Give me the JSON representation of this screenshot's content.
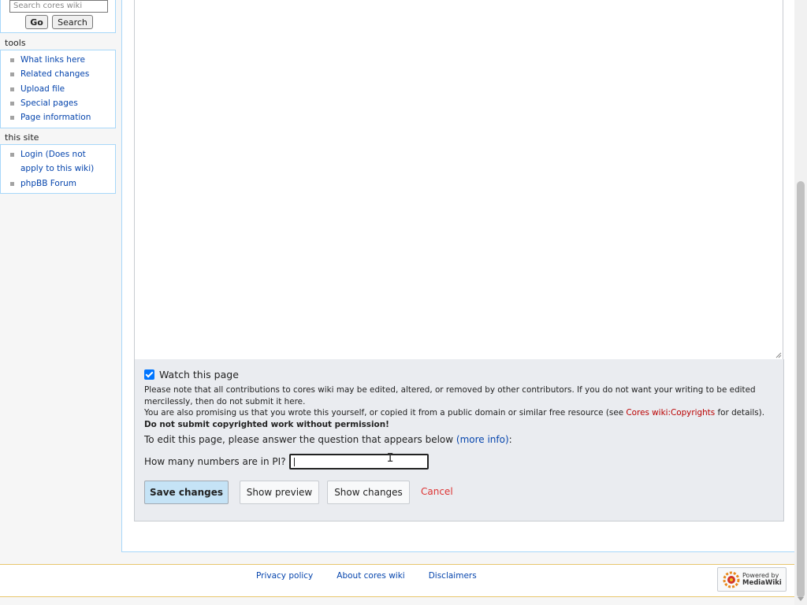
{
  "sidebar": {
    "search": {
      "placeholder": "Search cores wiki",
      "go_label": "Go",
      "search_label": "Search"
    },
    "tools": {
      "heading": "tools",
      "items": [
        {
          "label": "What links here"
        },
        {
          "label": "Related changes"
        },
        {
          "label": "Upload file"
        },
        {
          "label": "Special pages"
        },
        {
          "label": "Page information"
        }
      ]
    },
    "this_site": {
      "heading": "this site",
      "items": [
        {
          "label": "Login (Does not apply to this wiki)"
        },
        {
          "label": "phpBB Forum"
        }
      ]
    }
  },
  "editor": {
    "watch_label": "Watch this page",
    "watch_checked": true,
    "notice_line1": "Please note that all contributions to cores wiki may be edited, altered, or removed by other contributors. If you do not want your writing to be edited mercilessly, then do not submit it here.",
    "notice_line2_pre": "You are also promising us that you wrote this yourself, or copied it from a public domain or similar free resource (see ",
    "notice_copyright_link": "Cores wiki:Copyrights",
    "notice_line2_post": " for details). ",
    "notice_bold": "Do not submit copyrighted work without permission!",
    "question_intro_pre": "To edit this page, please answer the question that appears below ",
    "more_info_link": "(more info)",
    "question_intro_post": ":",
    "question": "How many numbers are in PI?",
    "answer_value": "",
    "save_label": "Save changes",
    "preview_label": "Show preview",
    "changes_label": "Show changes",
    "cancel_label": "Cancel"
  },
  "footer": {
    "links": [
      {
        "label": "Privacy policy"
      },
      {
        "label": "About cores wiki"
      },
      {
        "label": "Disclaimers"
      }
    ],
    "badge_line1": "Powered by",
    "badge_line2": "MediaWiki"
  },
  "colors": {
    "link": "#0645ad",
    "cancel": "#dd3333",
    "copyright_link": "#ba0000",
    "save_button": "#c5e3f6",
    "checkbox": "#0075ff"
  }
}
